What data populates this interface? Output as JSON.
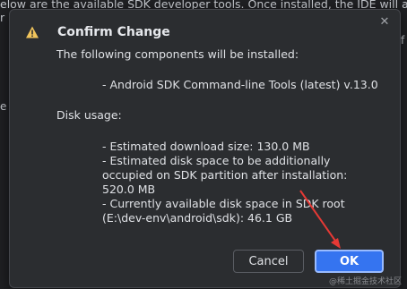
{
  "background": {
    "line1": "elow are the available SDK developer tools. Once installed, the IDE will au",
    "line2": "r",
    "left_edge_char": "e",
    "right_edge_char": "f"
  },
  "dialog": {
    "title": "Confirm Change",
    "intro": "The following components will be installed:",
    "component": "- Android SDK Command-line Tools (latest) v.13.0",
    "disk_usage_label": "Disk usage:",
    "details": [
      "- Estimated download size: 130.0 MB",
      "- Estimated disk space to be additionally",
      "occupied on SDK partition after installation:",
      "520.0 MB",
      "- Currently available disk space in SDK root",
      "(E:\\dev-env\\android\\sdk): 46.1 GB"
    ],
    "cancel_label": "Cancel",
    "ok_label": "OK",
    "close_glyph": "✕"
  },
  "colors": {
    "accent": "#3574f0",
    "annotation_arrow": "#e53935",
    "warning": "#f2c55c"
  },
  "icons": {
    "title": "warning-icon",
    "close": "close-icon"
  },
  "watermark": "@稀土掘金技术社区"
}
